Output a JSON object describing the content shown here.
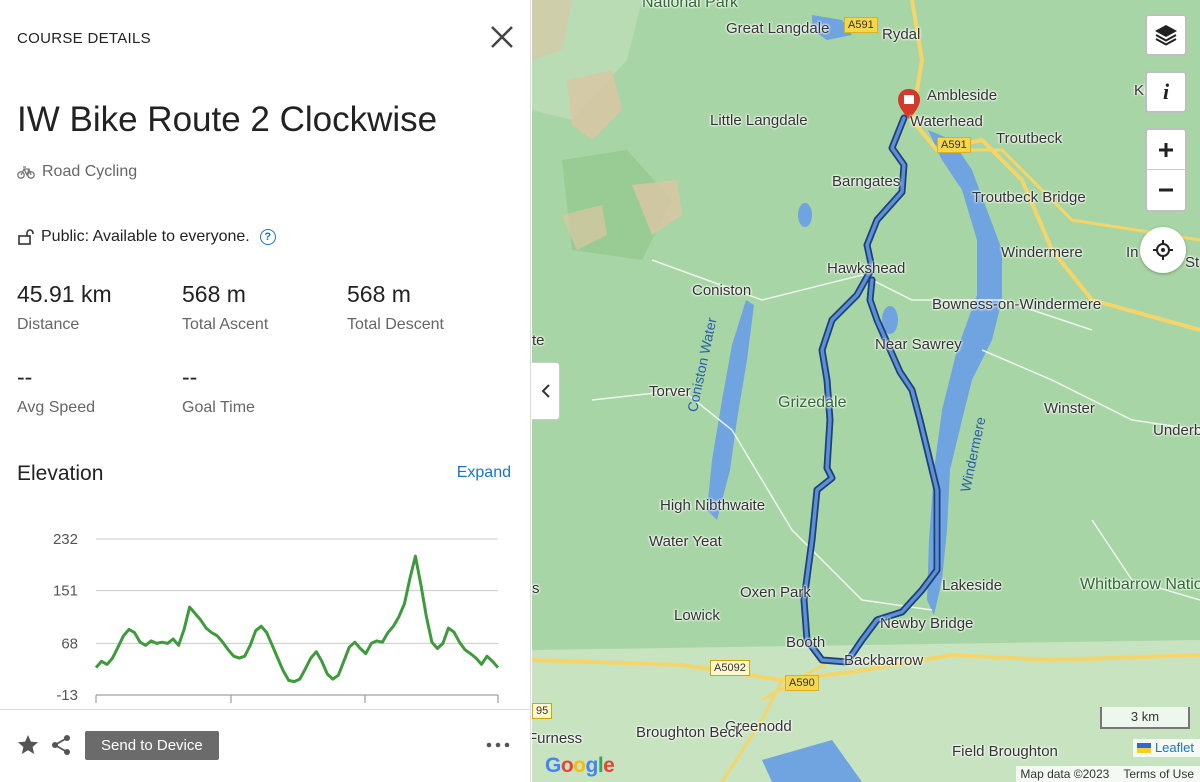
{
  "panel": {
    "header": "COURSE DETAILS",
    "title": "IW Bike Route 2 Clockwise",
    "activity_type": "Road Cycling",
    "privacy": "Public: Available to everyone.",
    "stats": [
      {
        "value": "45.91 km",
        "label": "Distance"
      },
      {
        "value": "568 m",
        "label": "Total Ascent"
      },
      {
        "value": "568 m",
        "label": "Total Descent"
      },
      {
        "value": "--",
        "label": "Avg Speed"
      },
      {
        "value": "--",
        "label": "Goal Time"
      }
    ],
    "elevation": {
      "heading": "Elevation",
      "expand_label": "Expand"
    },
    "footer": {
      "send_label": "Send to Device"
    }
  },
  "chart_data": {
    "type": "line",
    "title": "",
    "xlabel": "",
    "ylabel": "",
    "yticks": [
      "232",
      "151",
      "68",
      "-13"
    ],
    "ylim": [
      -13,
      232
    ],
    "series_color": "#3e9a3c",
    "series": [
      {
        "values": [
          30,
          40,
          35,
          45,
          62,
          80,
          90,
          85,
          70,
          65,
          72,
          68,
          70,
          68,
          75,
          65,
          90,
          125,
          115,
          105,
          92,
          85,
          80,
          70,
          58,
          48,
          45,
          48,
          65,
          88,
          95,
          85,
          65,
          45,
          25,
          10,
          8,
          12,
          28,
          45,
          55,
          40,
          20,
          12,
          18,
          40,
          62,
          70,
          60,
          52,
          68,
          72,
          70,
          85,
          95,
          110,
          130,
          170,
          205,
          160,
          110,
          70,
          60,
          68,
          92,
          86,
          70,
          58,
          52,
          45,
          35,
          48,
          40,
          30
        ]
      }
    ],
    "colors": {
      "accent": "#1a73c9",
      "elevation_line": "#3e9a3c",
      "route": "#3b73c4"
    }
  },
  "map": {
    "labels": [
      "National Park",
      "Great Langdale",
      "Rydal",
      "Ambleside",
      "Waterhead",
      "Little Langdale",
      "Troutbeck",
      "Barngates",
      "Troutbeck Bridge",
      "Windermere",
      "Hawkshead",
      "Coniston",
      "Bowness-on-Windermere",
      "Near Sawrey",
      "Torver",
      "Grizedale",
      "Winster",
      "Underb",
      "High Nibthwaite",
      "Water Yeat",
      "Oxen Park",
      "Lakeside",
      "Whitbarrow National Nature Reserve",
      "Lowick",
      "Newby Bridge",
      "Booth",
      "Backbarrow",
      "Furness",
      "Greenodd",
      "Broughton Beck",
      "Field Broughton",
      "Ki",
      "In",
      "Sta",
      "te",
      "s"
    ],
    "roads": [
      "A591",
      "A591",
      "A5092",
      "A590",
      "95"
    ],
    "water": [
      "Coniston Water",
      "Windermere"
    ],
    "scale_label": "3 km",
    "google": "Google",
    "leaflet": "Leaflet",
    "map_data": "Map data ©2023",
    "terms": "Terms of Use",
    "info_label": "i"
  }
}
